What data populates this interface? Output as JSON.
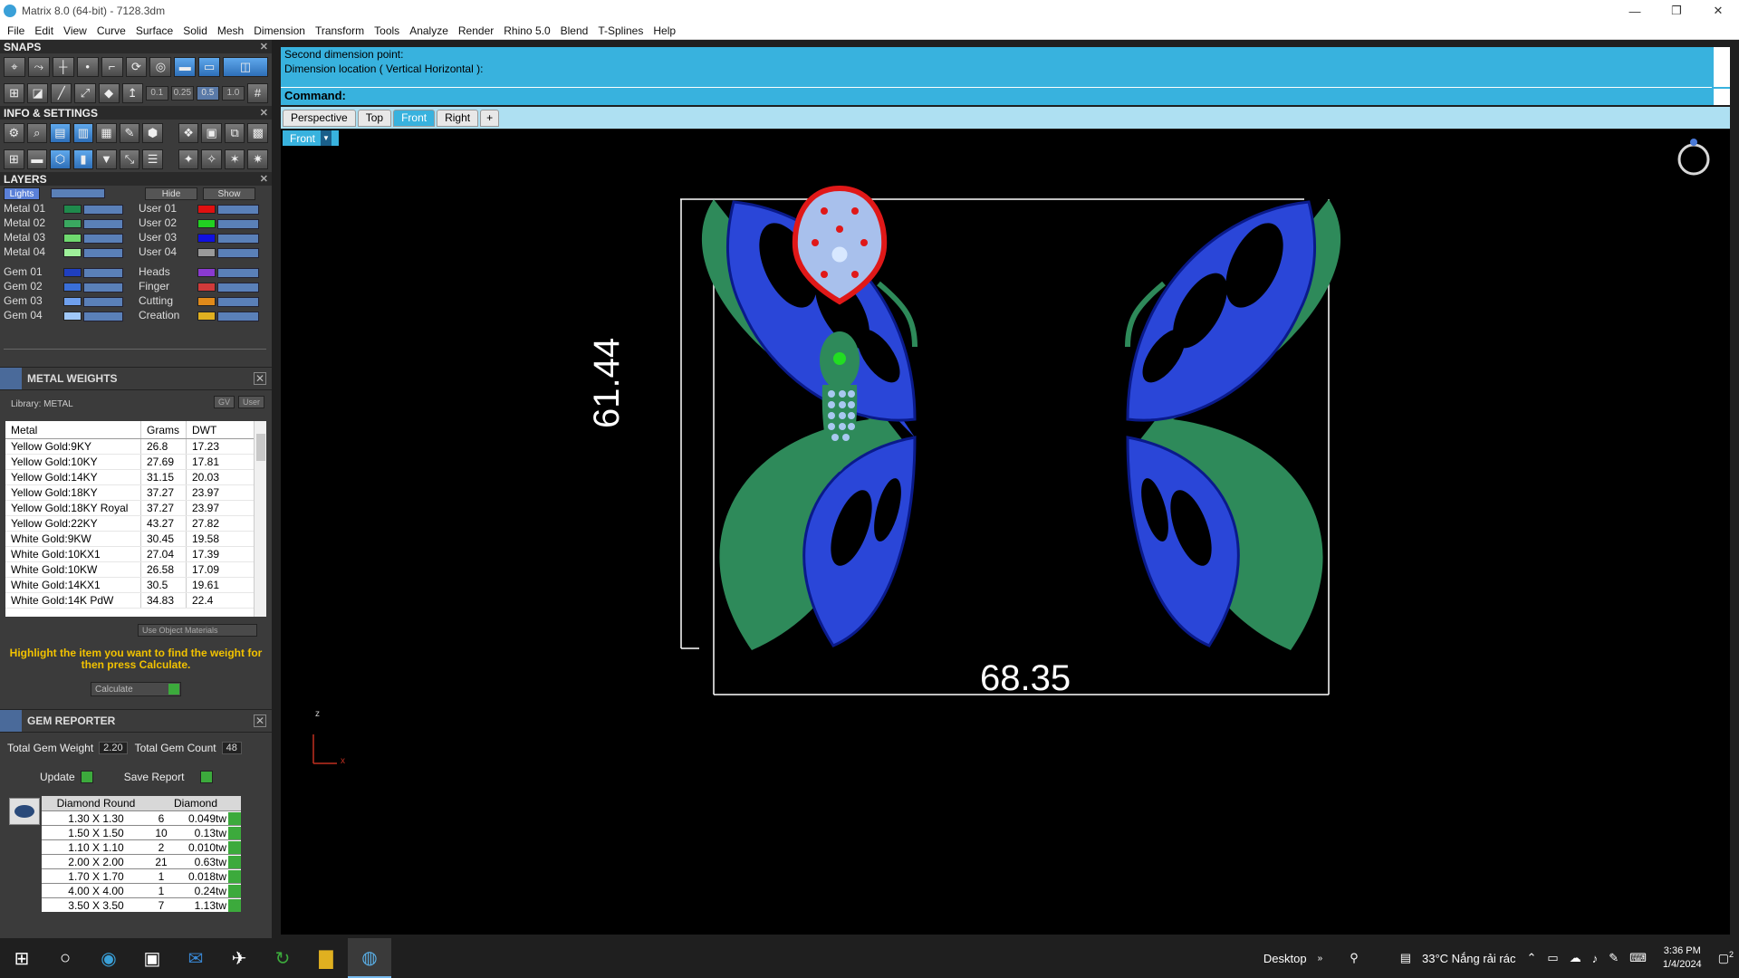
{
  "window": {
    "title": "Matrix 8.0 (64-bit) - 7128.3dm",
    "minimize": "—",
    "maximize": "❐",
    "close": "✕"
  },
  "menu": [
    "File",
    "Edit",
    "View",
    "Curve",
    "Surface",
    "Solid",
    "Mesh",
    "Dimension",
    "Transform",
    "Tools",
    "Analyze",
    "Render",
    "Rhino 5.0",
    "Blend",
    "T-Splines",
    "Help"
  ],
  "snaps": {
    "title": "SNAPS",
    "values": [
      "0.1",
      "0.25",
      "0.5",
      "1.0"
    ]
  },
  "info": {
    "title": "INFO & SETTINGS"
  },
  "layers": {
    "title": "LAYERS",
    "lights_label": "Lights",
    "hide_label": "Hide",
    "show_label": "Show",
    "left": [
      {
        "name": "Metal 01",
        "color": "#1f8a4c"
      },
      {
        "name": "Metal 02",
        "color": "#3aa860"
      },
      {
        "name": "Metal 03",
        "color": "#6fd96f"
      },
      {
        "name": "Metal 04",
        "color": "#9ef09a"
      },
      {
        "name": "Gem 01",
        "color": "#1f3fbf"
      },
      {
        "name": "Gem 02",
        "color": "#3a6fd8"
      },
      {
        "name": "Gem 03",
        "color": "#6fa0ee"
      },
      {
        "name": "Gem 04",
        "color": "#a0c8f8"
      }
    ],
    "right": [
      {
        "name": "User 01",
        "color": "#e01010"
      },
      {
        "name": "User 02",
        "color": "#22d022"
      },
      {
        "name": "User 03",
        "color": "#1010e0"
      },
      {
        "name": "User 04",
        "color": "#9a9a9a"
      },
      {
        "name": "Heads",
        "color": "#8a3ad0"
      },
      {
        "name": "Finger",
        "color": "#d03a3a"
      },
      {
        "name": "Cutting",
        "color": "#e08a1a"
      },
      {
        "name": "Creation",
        "color": "#e0b020"
      }
    ]
  },
  "metal_weights": {
    "title": "METAL WEIGHTS",
    "library": "Library: METAL",
    "tag_gv": "GV",
    "tag_user": "User",
    "columns": [
      "Metal",
      "Grams",
      "DWT"
    ],
    "rows": [
      [
        "Yellow Gold:9KY",
        "26.8",
        "17.23"
      ],
      [
        "Yellow Gold:10KY",
        "27.69",
        "17.81"
      ],
      [
        "Yellow Gold:14KY",
        "31.15",
        "20.03"
      ],
      [
        "Yellow Gold:18KY",
        "37.27",
        "23.97"
      ],
      [
        "Yellow Gold:18KY Royal",
        "37.27",
        "23.97"
      ],
      [
        "Yellow Gold:22KY",
        "43.27",
        "27.82"
      ],
      [
        "White Gold:9KW",
        "30.45",
        "19.58"
      ],
      [
        "White Gold:10KX1",
        "27.04",
        "17.39"
      ],
      [
        "White Gold:10KW",
        "26.58",
        "17.09"
      ],
      [
        "White Gold:14KX1",
        "30.5",
        "19.61"
      ],
      [
        "White Gold:14K PdW",
        "34.83",
        "22.4"
      ]
    ],
    "use_object": "Use Object Materials",
    "hint": "Highlight the item you want to find the weight for then press Calculate.",
    "calculate": "Calculate"
  },
  "gem_reporter": {
    "title": "GEM REPORTER",
    "total_weight_label": "Total Gem Weight",
    "total_weight": "2.20",
    "total_count_label": "Total Gem Count",
    "total_count": "48",
    "update": "Update",
    "save_report": "Save Report",
    "columns": [
      "Diamond Round",
      "Diamond"
    ],
    "rows": [
      [
        "1.30 X 1.30",
        "6",
        "0.049tw"
      ],
      [
        "1.50 X 1.50",
        "10",
        "0.13tw"
      ],
      [
        "1.10 X 1.10",
        "2",
        "0.010tw"
      ],
      [
        "2.00 X 2.00",
        "21",
        "0.63tw"
      ],
      [
        "1.70 X 1.70",
        "1",
        "0.018tw"
      ],
      [
        "4.00 X 4.00",
        "1",
        "0.24tw"
      ],
      [
        "3.50 X 3.50",
        "7",
        "1.13tw"
      ]
    ]
  },
  "command": {
    "lines": [
      "Second dimension point:",
      "Dimension location ( Vertical  Horizontal ):"
    ],
    "prompt": "Command:"
  },
  "tabs": [
    "Perspective",
    "Top",
    "Front",
    "Right",
    "+"
  ],
  "active_tab": "Front",
  "viewport": {
    "label": "Front",
    "dim_vertical": "61.44",
    "dim_horizontal": "68.35",
    "axis_z": "z",
    "axis_x": "x"
  },
  "taskbar": {
    "desktop": "Desktop",
    "weather": "33°C  Nắng rải rác",
    "time": "3:36 PM",
    "date": "1/4/2024",
    "notif": "2"
  }
}
